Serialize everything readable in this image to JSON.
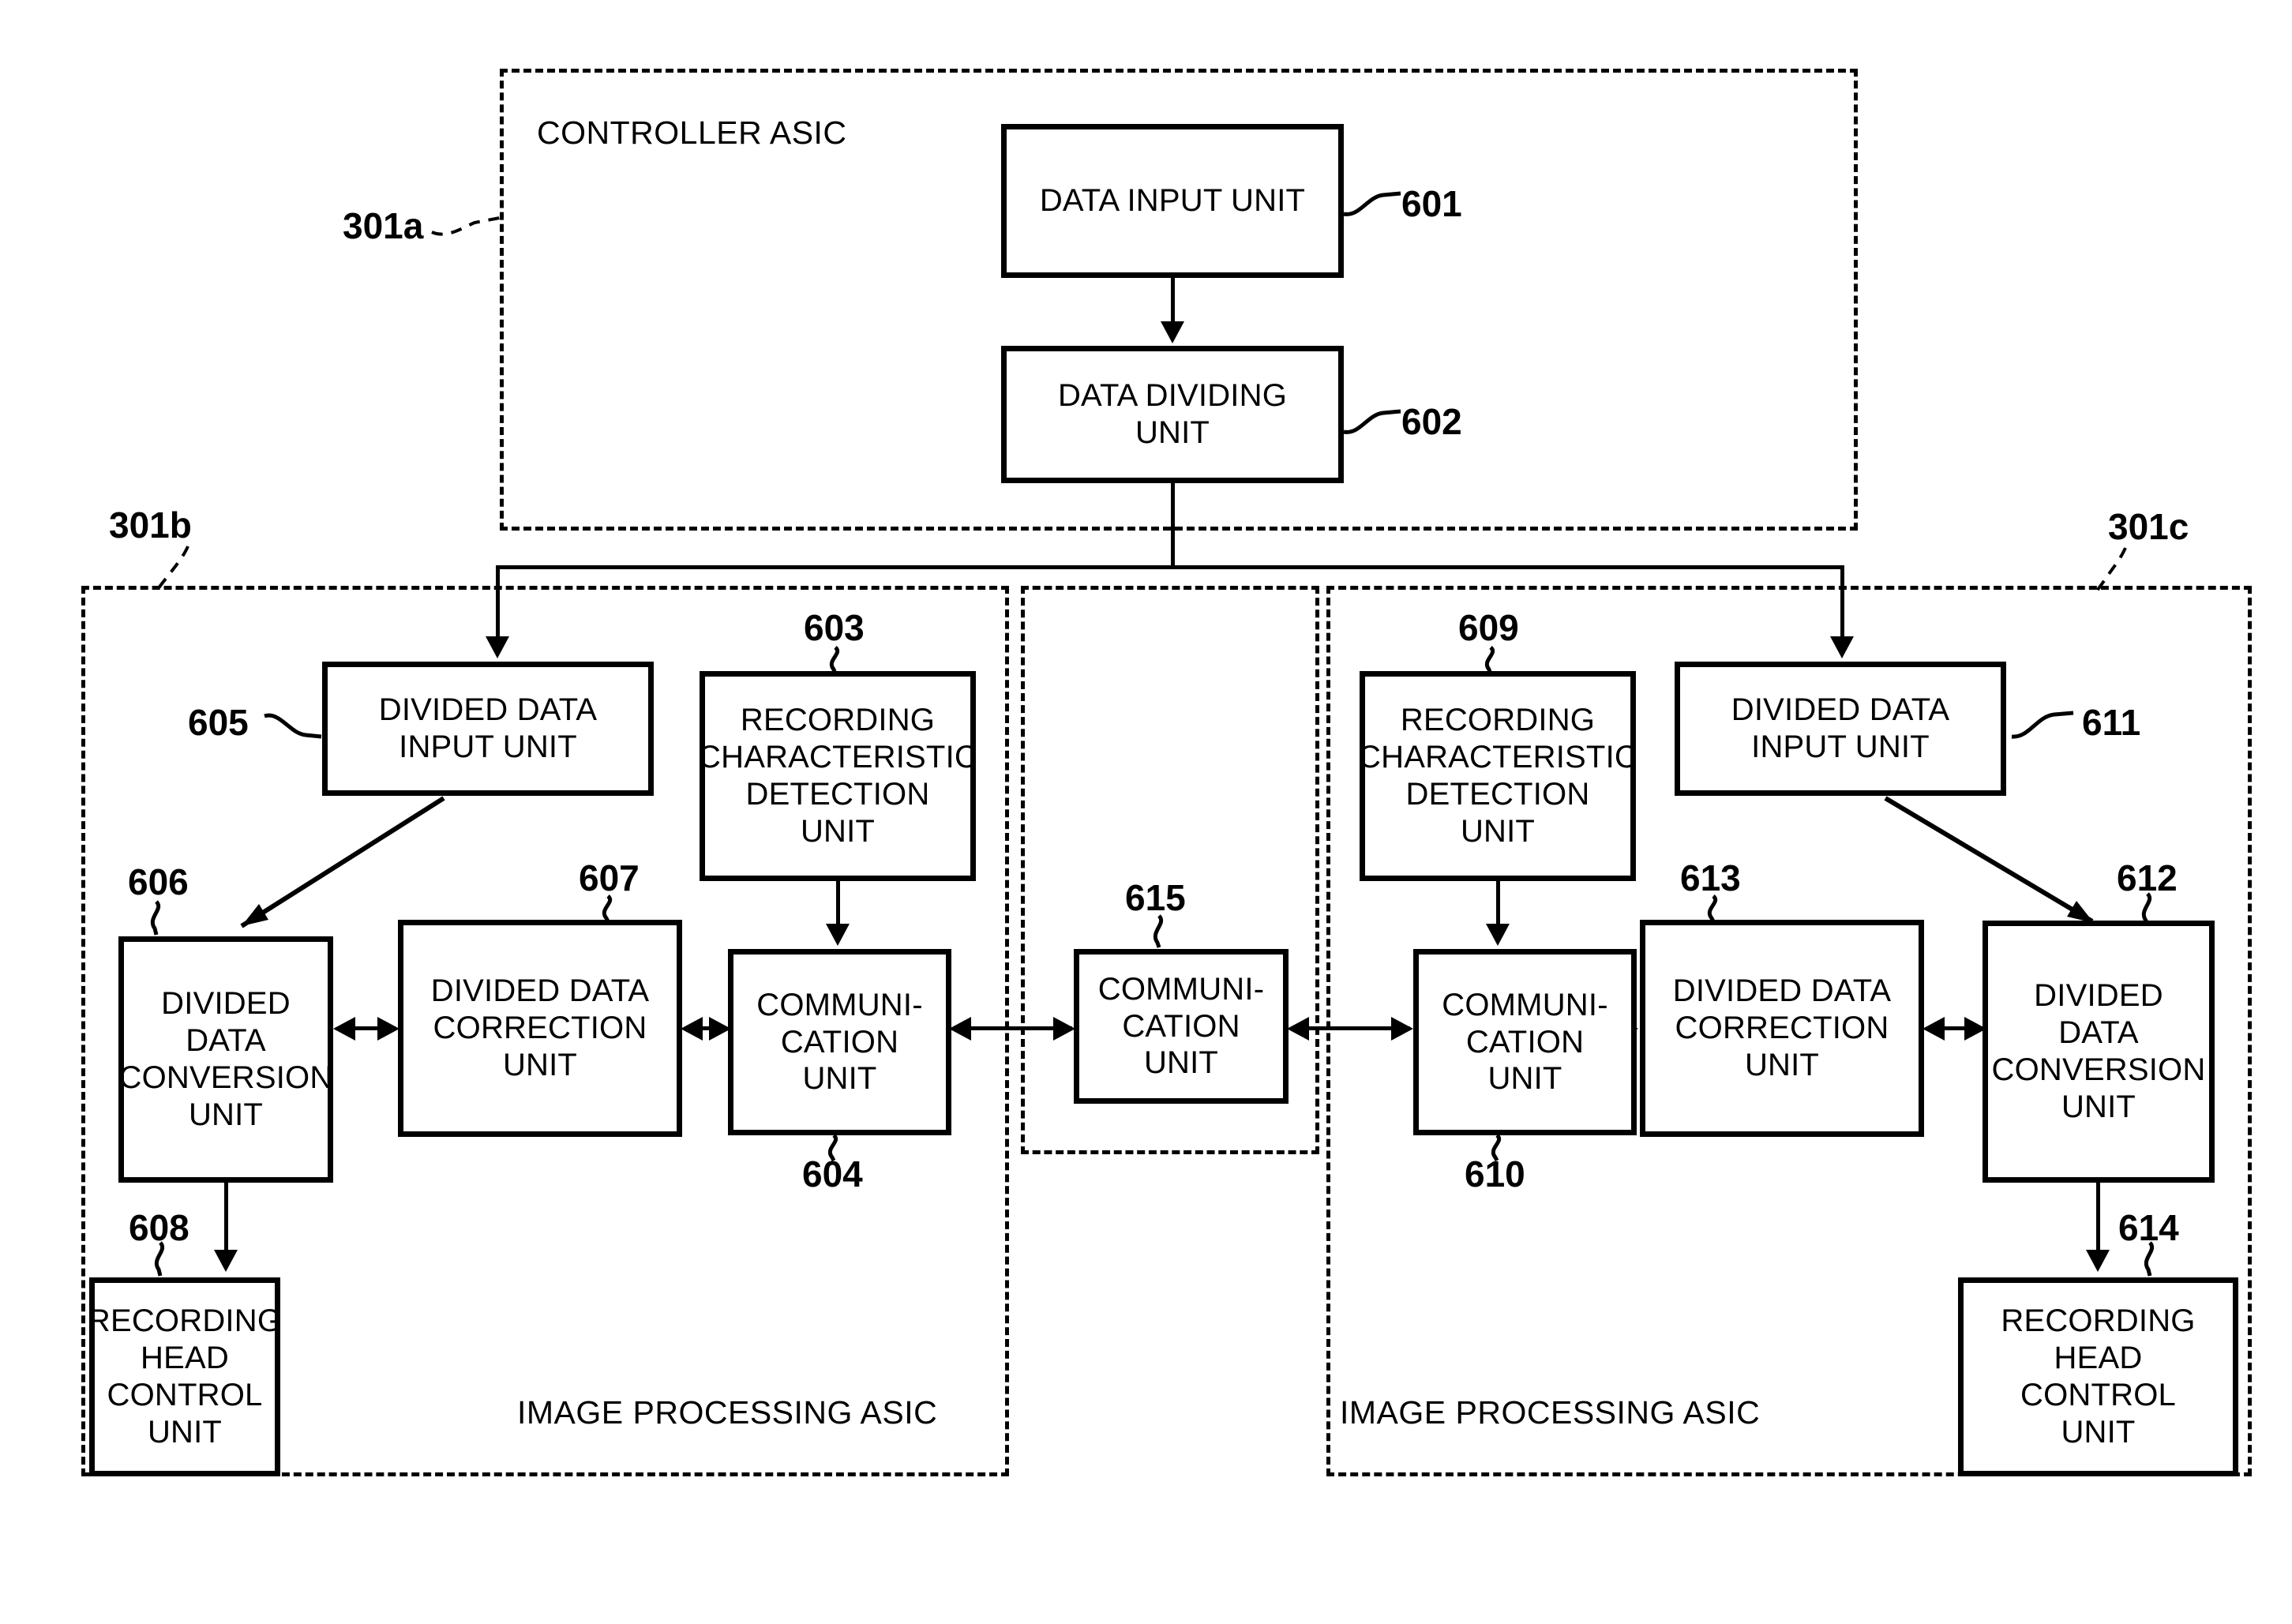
{
  "diagram": {
    "title_regions": [
      {
        "id": "301a",
        "label": "CONTROLLER ASIC",
        "ref": "301a"
      },
      {
        "id": "301b",
        "label": "IMAGE PROCESSING ASIC",
        "ref": "301b"
      },
      {
        "id": "301c",
        "label": "IMAGE PROCESSING ASIC",
        "ref": "301c"
      }
    ],
    "blocks": [
      {
        "ref": "601",
        "label": "DATA INPUT UNIT",
        "lines": [
          "DATA INPUT UNIT"
        ]
      },
      {
        "ref": "602",
        "label": "DATA DIVIDING UNIT",
        "lines": [
          "DATA DIVIDING",
          "UNIT"
        ]
      },
      {
        "ref": "603",
        "label": "RECORDING CHARACTERISTIC DETECTION UNIT",
        "lines": [
          "RECORDING",
          "CHARACTERISTIC",
          "DETECTION",
          "UNIT"
        ]
      },
      {
        "ref": "604",
        "label": "COMMUNICATION UNIT",
        "lines": [
          "COMMUNI-",
          "CATION",
          "UNIT"
        ]
      },
      {
        "ref": "605",
        "label": "DIVIDED DATA INPUT UNIT",
        "lines": [
          "DIVIDED DATA",
          "INPUT UNIT"
        ]
      },
      {
        "ref": "606",
        "label": "DIVIDED DATA CONVERSION UNIT",
        "lines": [
          "DIVIDED",
          "DATA",
          "CONVERSION",
          "UNIT"
        ]
      },
      {
        "ref": "607",
        "label": "DIVIDED DATA CORRECTION UNIT",
        "lines": [
          "DIVIDED DATA",
          "CORRECTION",
          "UNIT"
        ]
      },
      {
        "ref": "608",
        "label": "RECORDING HEAD CONTROL UNIT",
        "lines": [
          "RECORDING",
          "HEAD",
          "CONTROL",
          "UNIT"
        ]
      },
      {
        "ref": "609",
        "label": "RECORDING CHARACTERISTIC DETECTION UNIT",
        "lines": [
          "RECORDING",
          "CHARACTERISTIC",
          "DETECTION",
          "UNIT"
        ]
      },
      {
        "ref": "610",
        "label": "COMMUNICATION UNIT",
        "lines": [
          "COMMUNI-",
          "CATION",
          "UNIT"
        ]
      },
      {
        "ref": "611",
        "label": "DIVIDED DATA INPUT UNIT",
        "lines": [
          "DIVIDED DATA",
          "INPUT UNIT"
        ]
      },
      {
        "ref": "612",
        "label": "DIVIDED DATA CONVERSION UNIT",
        "lines": [
          "DIVIDED",
          "DATA",
          "CONVERSION",
          "UNIT"
        ]
      },
      {
        "ref": "613",
        "label": "DIVIDED DATA CORRECTION UNIT",
        "lines": [
          "DIVIDED DATA",
          "CORRECTION",
          "UNIT"
        ]
      },
      {
        "ref": "614",
        "label": "RECORDING HEAD CONTROL UNIT",
        "lines": [
          "RECORDING",
          "HEAD",
          "CONTROL",
          "UNIT"
        ]
      },
      {
        "ref": "615",
        "label": "COMMUNICATION UNIT",
        "lines": [
          "COMMUNI-",
          "CATION",
          "UNIT"
        ]
      }
    ],
    "text": {
      "controller_asic": "CONTROLLER ASIC",
      "image_processing_asic_left": "IMAGE PROCESSING ASIC",
      "image_processing_asic_right": "IMAGE PROCESSING ASIC",
      "ref_301a": "301a",
      "ref_301b": "301b",
      "ref_301c": "301c",
      "ref_601": "601",
      "ref_602": "602",
      "ref_603": "603",
      "ref_604": "604",
      "ref_605": "605",
      "ref_606": "606",
      "ref_607": "607",
      "ref_608": "608",
      "ref_609": "609",
      "ref_610": "610",
      "ref_611": "611",
      "ref_612": "612",
      "ref_613": "613",
      "ref_614": "614",
      "ref_615": "615",
      "b601_l1": "DATA INPUT UNIT",
      "b602_l1": "DATA DIVIDING",
      "b602_l2": "UNIT",
      "b603_l1": "RECORDING",
      "b603_l2": "CHARACTERISTIC",
      "b603_l3": "DETECTION",
      "b603_l4": "UNIT",
      "b604_l1": "COMMUNI-",
      "b604_l2": "CATION",
      "b604_l3": "UNIT",
      "b605_l1": "DIVIDED DATA",
      "b605_l2": "INPUT UNIT",
      "b606_l1": "DIVIDED",
      "b606_l2": "DATA",
      "b606_l3": "CONVERSION",
      "b606_l4": "UNIT",
      "b607_l1": "DIVIDED DATA",
      "b607_l2": "CORRECTION",
      "b607_l3": "UNIT",
      "b608_l1": "RECORDING",
      "b608_l2": "HEAD",
      "b608_l3": "CONTROL",
      "b608_l4": "UNIT",
      "b609_l1": "RECORDING",
      "b609_l2": "CHARACTERISTIC",
      "b609_l3": "DETECTION",
      "b609_l4": "UNIT",
      "b610_l1": "COMMUNI-",
      "b610_l2": "CATION",
      "b610_l3": "UNIT",
      "b611_l1": "DIVIDED DATA",
      "b611_l2": "INPUT UNIT",
      "b612_l1": "DIVIDED",
      "b612_l2": "DATA",
      "b612_l3": "CONVERSION",
      "b612_l4": "UNIT",
      "b613_l1": "DIVIDED DATA",
      "b613_l2": "CORRECTION",
      "b613_l3": "UNIT",
      "b614_l1": "RECORDING",
      "b614_l2": "HEAD",
      "b614_l3": "CONTROL",
      "b614_l4": "UNIT",
      "b615_l1": "COMMUNI-",
      "b615_l2": "CATION",
      "b615_l3": "UNIT"
    },
    "colors": {
      "ink": "#000000",
      "paper": "#ffffff"
    }
  }
}
